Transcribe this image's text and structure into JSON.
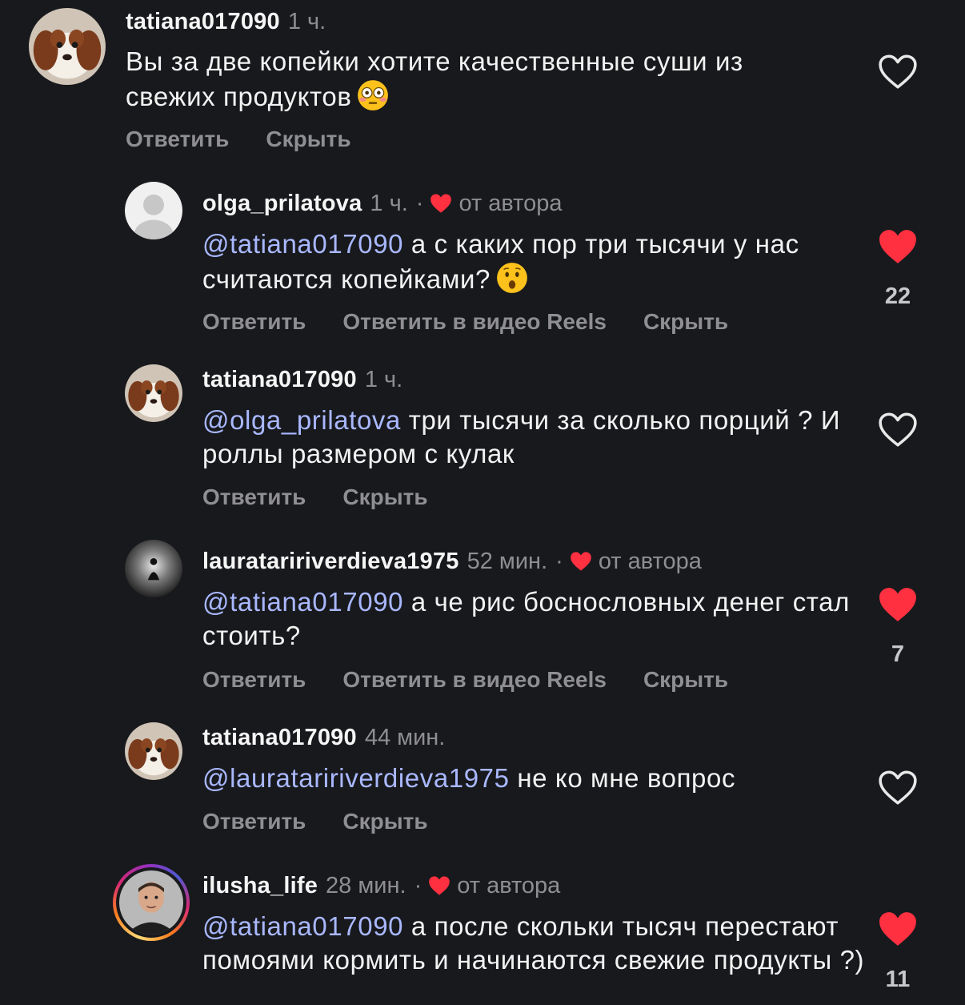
{
  "comments": [
    {
      "username": "tatiana017090",
      "time": "1 ч.",
      "text_before": "Вы за две копейки хотите качественные суши из свежих продуктов",
      "emoji": "flushed-face",
      "actions": [
        "Ответить",
        "Скрыть"
      ],
      "liked": false
    },
    {
      "username": "olga_prilatova",
      "time": "1 ч.",
      "dot": "·",
      "by_author": "от автора",
      "mention": "@tatiana017090",
      "text_after": " а с каких пор три тысячи у нас считаются копейками?",
      "emoji": "hushed-face",
      "actions": [
        "Ответить",
        "Ответить в видео Reels",
        "Скрыть"
      ],
      "liked": true,
      "likes": "22"
    },
    {
      "username": "tatiana017090",
      "time": "1 ч.",
      "mention": "@olga_prilatova",
      "text_after": " три тысячи за сколько порций ? И роллы размером с кулак",
      "actions": [
        "Ответить",
        "Скрыть"
      ],
      "liked": false
    },
    {
      "username": "laurataririverdieva1975",
      "time": "52 мин.",
      "dot": "·",
      "by_author": "от автора",
      "mention": "@tatiana017090",
      "text_after": " а че рис боснословных денег стал стоить?",
      "actions": [
        "Ответить",
        "Ответить в видео Reels",
        "Скрыть"
      ],
      "liked": true,
      "likes": "7"
    },
    {
      "username": "tatiana017090",
      "time": "44 мин.",
      "mention": "@laurataririverdieva1975",
      "text_after": " не ко мне вопрос",
      "actions": [
        "Ответить",
        "Скрыть"
      ],
      "liked": false
    },
    {
      "username": "ilusha_life",
      "time": "28 мин.",
      "dot": "·",
      "by_author": "от автора",
      "mention": "@tatiana017090",
      "text_after": " а после скольки тысяч перестают помоями кормить и начинаются свежие продукты ?)",
      "liked": true,
      "likes": "11"
    }
  ],
  "colors": {
    "background": "#18191d",
    "mention": "#a9b8ff",
    "heart_red": "#ff3040",
    "muted": "#8e8e93"
  }
}
